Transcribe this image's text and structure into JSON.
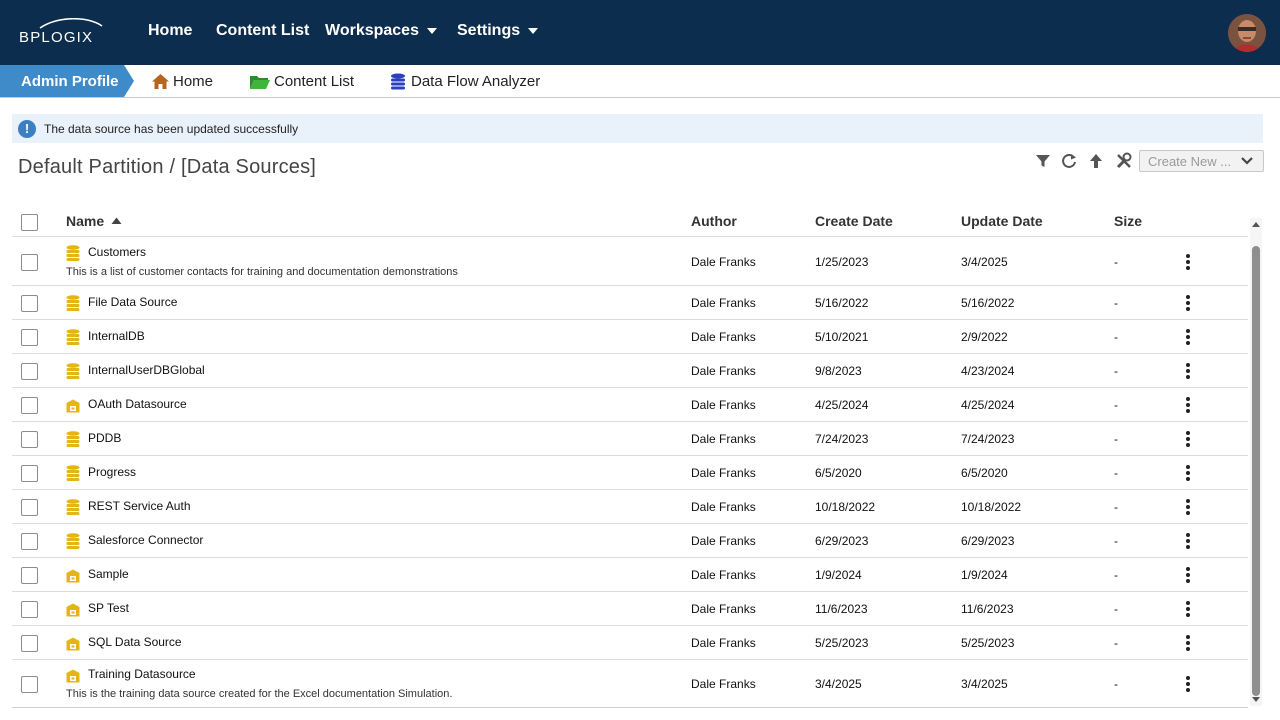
{
  "nav": {
    "logo_text": "BPLOGIX",
    "items": [
      {
        "label": "Home",
        "dropdown": false
      },
      {
        "label": "Content List",
        "dropdown": false
      },
      {
        "label": "Workspaces",
        "dropdown": true
      },
      {
        "label": "Settings",
        "dropdown": true
      }
    ]
  },
  "breadcrumbs": {
    "profile": "Admin Profile",
    "items": [
      {
        "label": "Home",
        "icon": "home-icon",
        "color": "#b5651d"
      },
      {
        "label": "Content List",
        "icon": "folder-icon",
        "color": "#3aa935"
      },
      {
        "label": "Data Flow Analyzer",
        "icon": "database-icon",
        "color": "#2b3fbf"
      }
    ]
  },
  "message": {
    "text": "The data source has been updated successfully",
    "icon": "info-icon"
  },
  "page_title": "Default Partition / [Data Sources]",
  "toolbar": {
    "create_new": "Create New ..."
  },
  "table": {
    "headers": {
      "name": "Name",
      "author": "Author",
      "create_date": "Create Date",
      "update_date": "Update Date",
      "size": "Size"
    },
    "rows": [
      {
        "name": "Customers",
        "desc": "This is a list of customer contacts for training and documentation demonstrations",
        "icon": "database-icon",
        "author": "Dale Franks",
        "create": "1/25/2023",
        "update": "3/4/2025",
        "size": "-"
      },
      {
        "name": "File Data Source",
        "desc": "",
        "icon": "database-icon",
        "author": "Dale Franks",
        "create": "5/16/2022",
        "update": "5/16/2022",
        "size": "-"
      },
      {
        "name": "InternalDB",
        "desc": "",
        "icon": "database-icon",
        "author": "Dale Franks",
        "create": "5/10/2021",
        "update": "2/9/2022",
        "size": "-"
      },
      {
        "name": "InternalUserDBGlobal",
        "desc": "",
        "icon": "database-icon",
        "author": "Dale Franks",
        "create": "9/8/2023",
        "update": "4/23/2024",
        "size": "-"
      },
      {
        "name": "OAuth Datasource",
        "desc": "",
        "icon": "connector-icon",
        "author": "Dale Franks",
        "create": "4/25/2024",
        "update": "4/25/2024",
        "size": "-"
      },
      {
        "name": "PDDB",
        "desc": "",
        "icon": "database-icon",
        "author": "Dale Franks",
        "create": "7/24/2023",
        "update": "7/24/2023",
        "size": "-"
      },
      {
        "name": "Progress",
        "desc": "",
        "icon": "database-icon",
        "author": "Dale Franks",
        "create": "6/5/2020",
        "update": "6/5/2020",
        "size": "-"
      },
      {
        "name": "REST Service Auth",
        "desc": "",
        "icon": "database-icon",
        "author": "Dale Franks",
        "create": "10/18/2022",
        "update": "10/18/2022",
        "size": "-"
      },
      {
        "name": "Salesforce Connector",
        "desc": "",
        "icon": "database-icon",
        "author": "Dale Franks",
        "create": "6/29/2023",
        "update": "6/29/2023",
        "size": "-"
      },
      {
        "name": "Sample",
        "desc": "",
        "icon": "connector-icon",
        "author": "Dale Franks",
        "create": "1/9/2024",
        "update": "1/9/2024",
        "size": "-"
      },
      {
        "name": "SP Test",
        "desc": "",
        "icon": "connector-icon",
        "author": "Dale Franks",
        "create": "11/6/2023",
        "update": "11/6/2023",
        "size": "-"
      },
      {
        "name": "SQL Data Source",
        "desc": "",
        "icon": "connector-icon",
        "author": "Dale Franks",
        "create": "5/25/2023",
        "update": "5/25/2023",
        "size": "-"
      },
      {
        "name": "Training Datasource",
        "desc": "This is the training data source created for the Excel documentation Simulation.",
        "icon": "connector-icon",
        "author": "Dale Franks",
        "create": "3/4/2025",
        "update": "3/4/2025",
        "size": "-"
      }
    ]
  },
  "colors": {
    "nav_bg": "#0c2d4d",
    "profile_tab": "#3f8ac9",
    "icon_gold": "#e3b515",
    "message_bg": "#e9f1fa"
  }
}
